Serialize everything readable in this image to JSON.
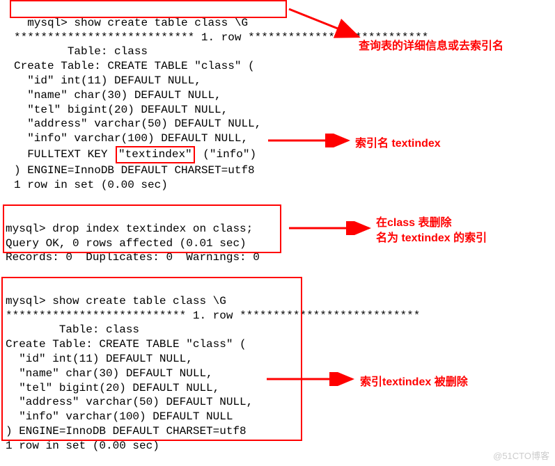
{
  "block1": {
    "pre": "  mysql> ",
    "cmd": "show create table class \\G",
    "stars_left": "***************************",
    "row_marker": " 1. row ",
    "stars_right": "***************************",
    "table_line": "        Table: class",
    "create_table": "Create Table: CREATE TABLE \"class\" (",
    "col_id": "  \"id\" int(11) DEFAULT NULL,",
    "col_name": "  \"name\" char(30) DEFAULT NULL,",
    "col_tel": "  \"tel\" bigint(20) DEFAULT NULL,",
    "col_address": "  \"address\" varchar(50) DEFAULT NULL,",
    "col_info": "  \"info\" varchar(100) DEFAULT NULL,",
    "fulltext_pre": "  FULLTEXT KEY ",
    "fulltext_idx": "\"textindex\"",
    "fulltext_post": " (\"info\")",
    "engine": ") ENGINE=InnoDB DEFAULT CHARSET=utf8",
    "footer": "1 row in set (0.00 sec)"
  },
  "block2": {
    "line1": "mysql> drop index textindex on class;",
    "line2": "Query OK, 0 rows affected (0.01 sec)",
    "line3": "Records: 0  Duplicates: 0  Warnings: 0"
  },
  "block3": {
    "line_cmd": "mysql> show create table class \\G",
    "stars_left": "***************************",
    "row_marker": " 1. row ",
    "stars_right": "***************************",
    "table_line": "        Table: class",
    "create_table": "Create Table: CREATE TABLE \"class\" (",
    "col_id": "  \"id\" int(11) DEFAULT NULL,",
    "col_name": "  \"name\" char(30) DEFAULT NULL,",
    "col_tel": "  \"tel\" bigint(20) DEFAULT NULL,",
    "col_address": "  \"address\" varchar(50) DEFAULT NULL,",
    "col_info": "  \"info\" varchar(100) DEFAULT NULL",
    "engine": ") ENGINE=InnoDB DEFAULT CHARSET=utf8",
    "footer": "1 row in set (0.00 sec)"
  },
  "annotations": {
    "a1": "查询表的详细信息或去索引名",
    "a2": "索引名 textindex",
    "a3_l1": "在class 表删除",
    "a3_l2": "名为 textindex 的索引",
    "a4": "索引textindex 被删除"
  },
  "watermark": "@51CTO博客",
  "colors": {
    "red": "#ff0000"
  }
}
